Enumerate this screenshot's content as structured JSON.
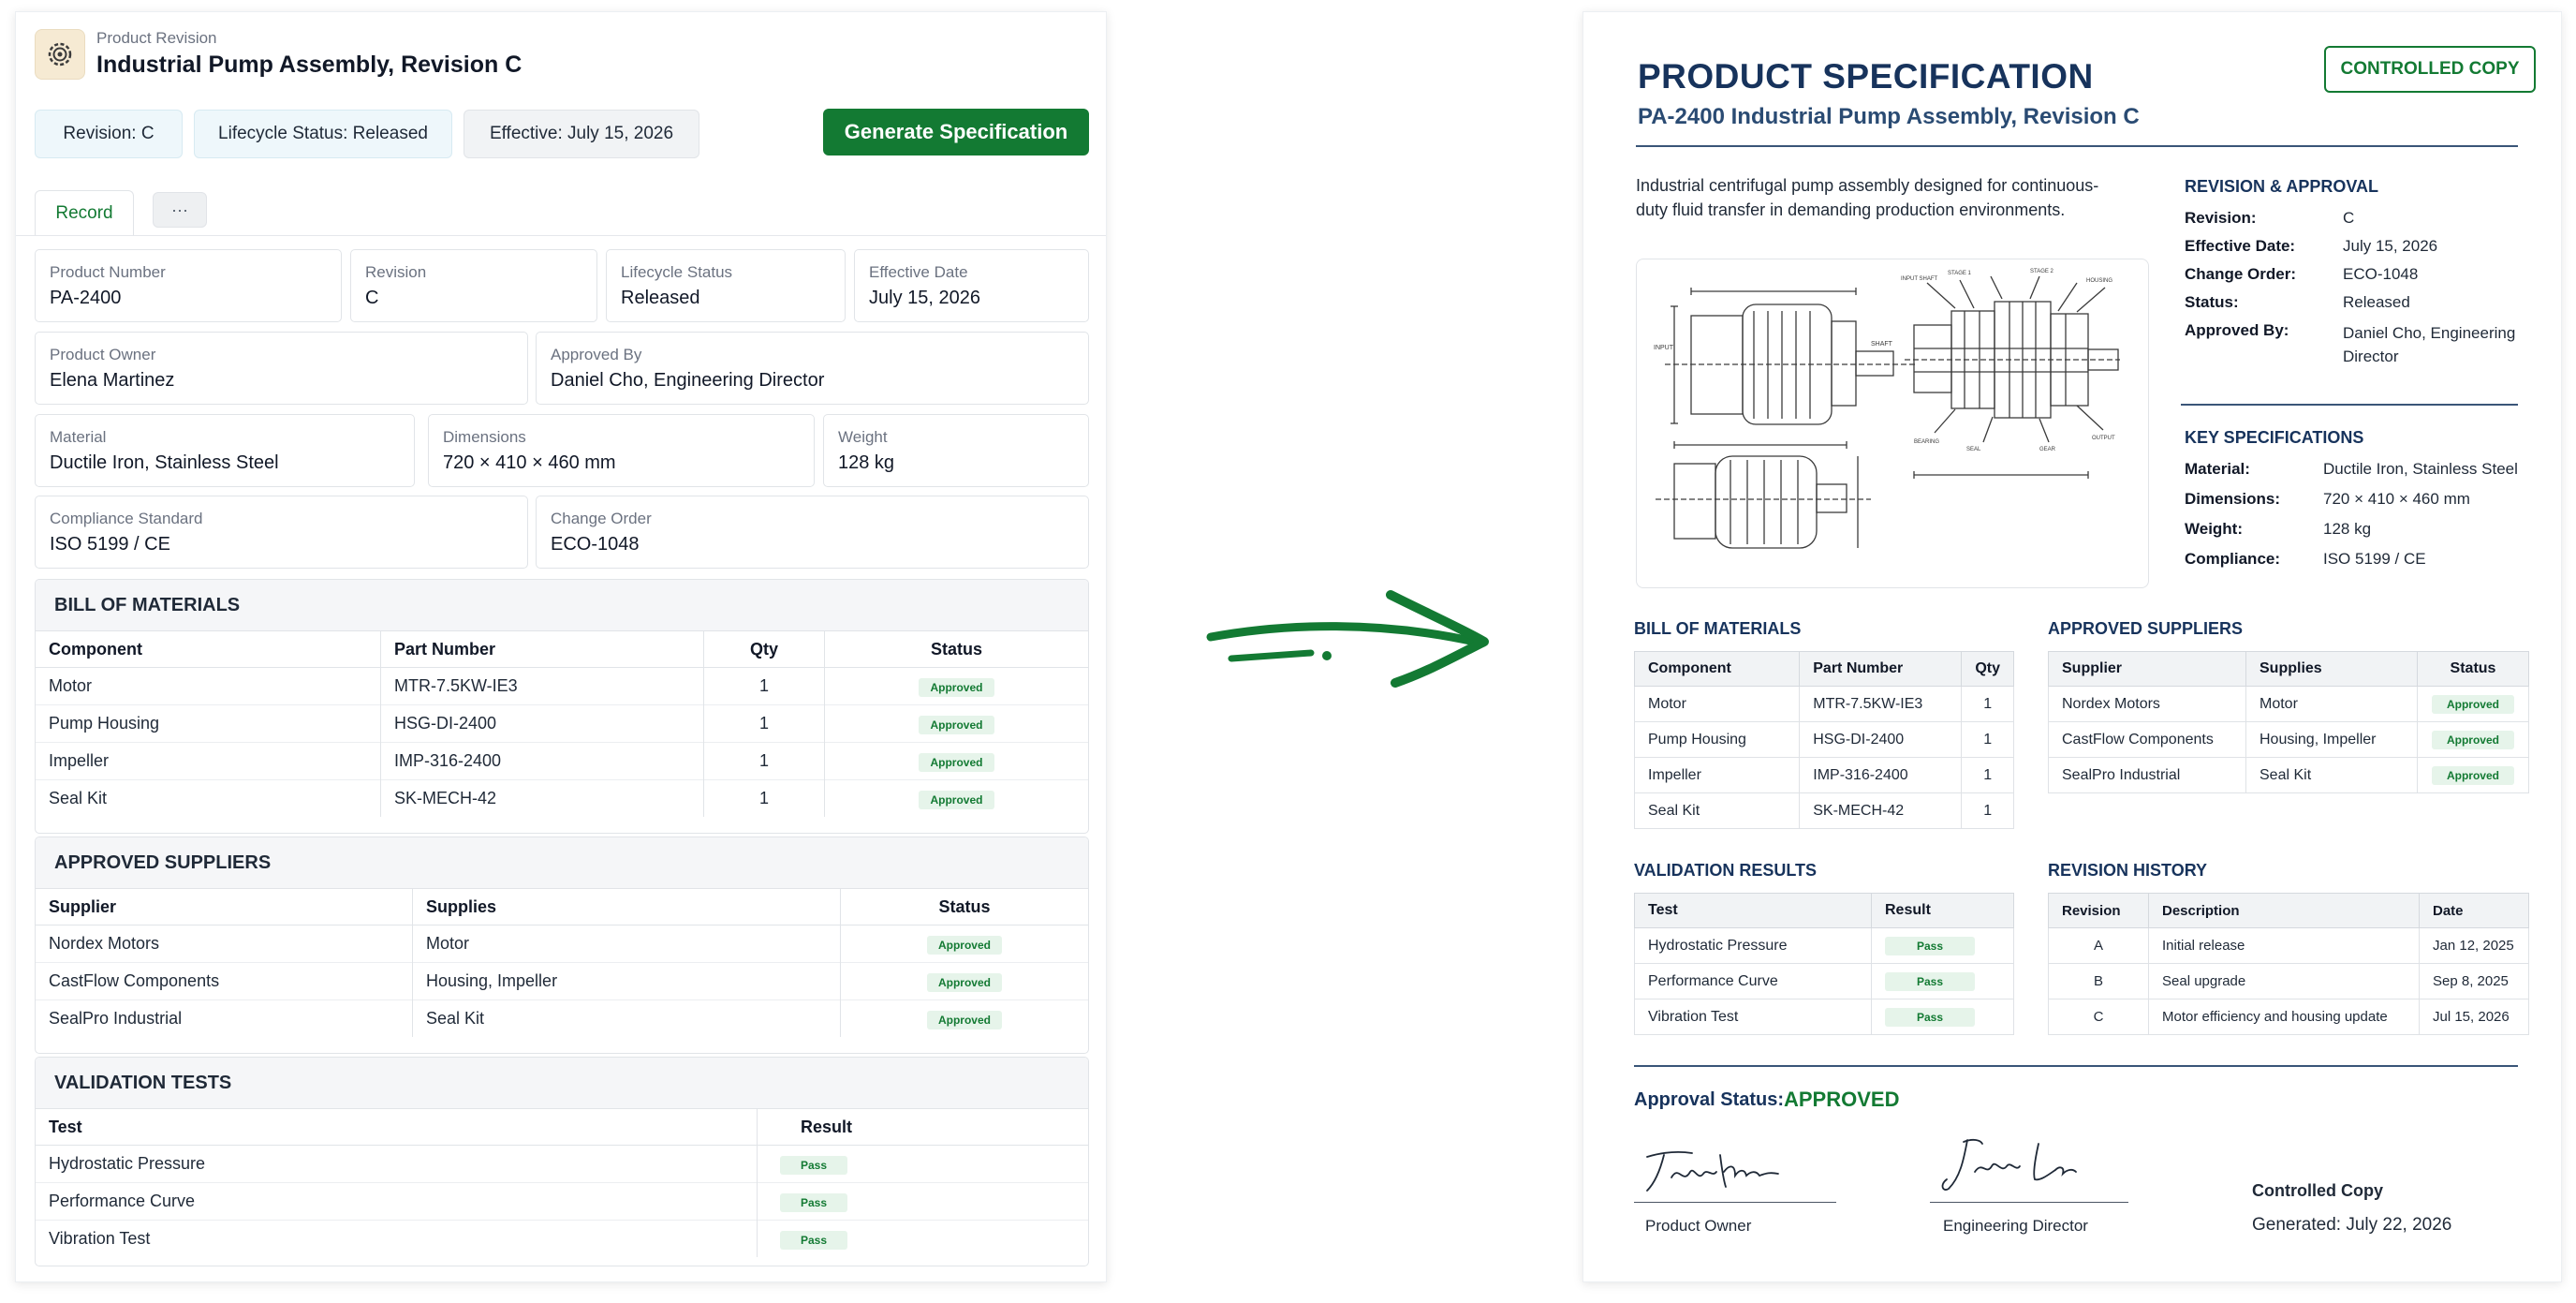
{
  "record": {
    "breadcrumb": "Product Revision",
    "title": "Industrial Pump Assembly, Revision C",
    "chips": [
      "Revision: C",
      "Lifecycle Status: Released",
      "Effective: July 15, 2026"
    ],
    "generate_button": "Generate Specification",
    "tabs": {
      "record": "Record",
      "more": "···"
    },
    "fields": {
      "product_number": {
        "label": "Product Number",
        "value": "PA-2400"
      },
      "revision": {
        "label": "Revision",
        "value": "C"
      },
      "lifecycle_status": {
        "label": "Lifecycle Status",
        "value": "Released"
      },
      "effective_date": {
        "label": "Effective Date",
        "value": "July 15, 2026"
      },
      "product_owner": {
        "label": "Product Owner",
        "value": "Elena Martinez"
      },
      "approved_by": {
        "label": "Approved By",
        "value": "Daniel Cho, Engineering Director"
      },
      "material": {
        "label": "Material",
        "value": "Ductile Iron, Stainless Steel"
      },
      "dimensions": {
        "label": "Dimensions",
        "value": "720 × 410 × 460 mm"
      },
      "weight": {
        "label": "Weight",
        "value": "128 kg"
      },
      "compliance_standard": {
        "label": "Compliance Standard",
        "value": "ISO 5199 / CE"
      },
      "change_order": {
        "label": "Change Order",
        "value": "ECO-1048"
      }
    },
    "bom": {
      "title": "BILL OF MATERIALS",
      "headers": [
        "Component",
        "Part Number",
        "Qty",
        "Status"
      ],
      "rows": [
        [
          "Motor",
          "MTR-7.5KW-IE3",
          "1",
          "Approved"
        ],
        [
          "Pump Housing",
          "HSG-DI-2400",
          "1",
          "Approved"
        ],
        [
          "Impeller",
          "IMP-316-2400",
          "1",
          "Approved"
        ],
        [
          "Seal Kit",
          "SK-MECH-42",
          "1",
          "Approved"
        ]
      ]
    },
    "suppliers": {
      "title": "APPROVED SUPPLIERS",
      "headers": [
        "Supplier",
        "Supplies",
        "Status"
      ],
      "rows": [
        [
          "Nordex Motors",
          "Motor",
          "Approved"
        ],
        [
          "CastFlow Components",
          "Housing, Impeller",
          "Approved"
        ],
        [
          "SealPro Industrial",
          "Seal Kit",
          "Approved"
        ]
      ]
    },
    "validation": {
      "title": "VALIDATION TESTS",
      "headers": [
        "Test",
        "Result"
      ],
      "rows": [
        [
          "Hydrostatic Pressure",
          "Pass"
        ],
        [
          "Performance Curve",
          "Pass"
        ],
        [
          "Vibration Test",
          "Pass"
        ]
      ]
    }
  },
  "spec": {
    "title": "PRODUCT SPECIFICATION",
    "subtitle": "PA-2400 Industrial Pump Assembly, Revision C",
    "badge": "CONTROLLED COPY",
    "description": "Industrial centrifugal pump assembly designed for continuous-duty fluid transfer in demanding production environments.",
    "revision_approval": {
      "title": "REVISION & APPROVAL",
      "rows": [
        {
          "label": "Revision:",
          "value": "C"
        },
        {
          "label": "Effective Date:",
          "value": "July 15, 2026"
        },
        {
          "label": "Change Order:",
          "value": "ECO-1048"
        },
        {
          "label": "Status:",
          "value": "Released"
        },
        {
          "label": "Approved By:",
          "value": "Daniel Cho, Engineering Director"
        }
      ]
    },
    "key_specs": {
      "title": "KEY SPECIFICATIONS",
      "rows": [
        {
          "label": "Material:",
          "value": "Ductile Iron, Stainless Steel"
        },
        {
          "label": "Dimensions:",
          "value": "720 × 410 × 460 mm"
        },
        {
          "label": "Weight:",
          "value": "128 kg"
        },
        {
          "label": "Compliance:",
          "value": "ISO 5199 / CE"
        }
      ]
    },
    "bom": {
      "title": "BILL OF MATERIALS",
      "headers": [
        "Component",
        "Part Number",
        "Qty"
      ],
      "rows": [
        [
          "Motor",
          "MTR-7.5KW-IE3",
          "1"
        ],
        [
          "Pump Housing",
          "HSG-DI-2400",
          "1"
        ],
        [
          "Impeller",
          "IMP-316-2400",
          "1"
        ],
        [
          "Seal Kit",
          "SK-MECH-42",
          "1"
        ]
      ]
    },
    "suppliers": {
      "title": "APPROVED SUPPLIERS",
      "headers": [
        "Supplier",
        "Supplies",
        "Status"
      ],
      "rows": [
        [
          "Nordex Motors",
          "Motor",
          "Approved"
        ],
        [
          "CastFlow Components",
          "Housing, Impeller",
          "Approved"
        ],
        [
          "SealPro Industrial",
          "Seal Kit",
          "Approved"
        ]
      ]
    },
    "validation": {
      "title": "VALIDATION RESULTS",
      "headers": [
        "Test",
        "Result"
      ],
      "rows": [
        [
          "Hydrostatic Pressure",
          "Pass"
        ],
        [
          "Performance Curve",
          "Pass"
        ],
        [
          "Vibration Test",
          "Pass"
        ]
      ]
    },
    "history": {
      "title": "REVISION HISTORY",
      "headers": [
        "Revision",
        "Description",
        "Date"
      ],
      "rows": [
        [
          "A",
          "Initial release",
          "Jan 12, 2025"
        ],
        [
          "B",
          "Seal upgrade",
          "Sep 8, 2025"
        ],
        [
          "C",
          "Motor efficiency and housing update",
          "Jul 15, 2026"
        ]
      ]
    },
    "approval_status_label": "Approval Status:",
    "approval_status_value": "APPROVED",
    "signatures": {
      "owner_signature": "Fanch Haven",
      "owner_caption": "Product Owner",
      "director_signature": "Jasch Le",
      "director_caption": "Engineering Director"
    },
    "footer": {
      "controlled": "Controlled Copy",
      "generated": "Generated: July 22, 2026"
    }
  },
  "colors": {
    "brand_green": "#137a33",
    "navy": "#17335c",
    "pass_bg": "#e6f4ea"
  }
}
